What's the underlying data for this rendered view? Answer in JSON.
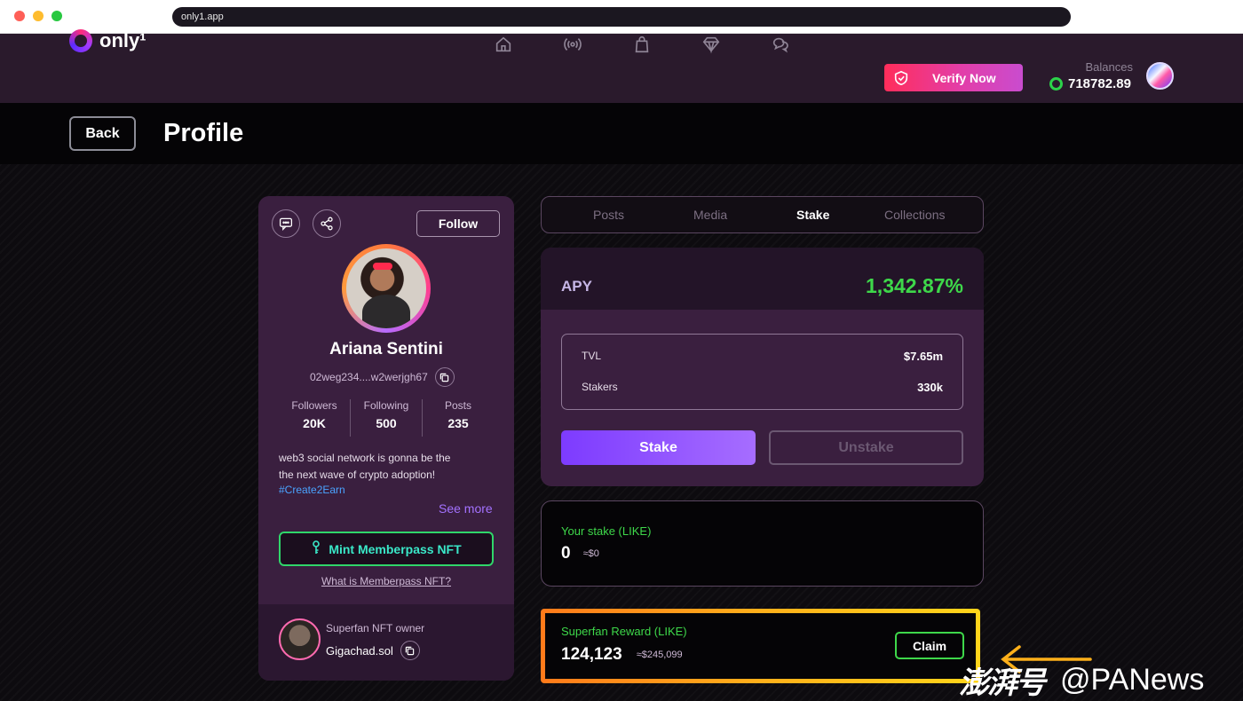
{
  "browser": {
    "url": "only1.app"
  },
  "header": {
    "logo_text": "only¹",
    "nav_icons": [
      "home-icon",
      "live-broadcast-icon",
      "shopping-bag-icon",
      "diamond-icon",
      "chat-bubbles-icon"
    ],
    "verify_label": "Verify Now",
    "balances_label": "Balances",
    "balances_value": "718782.89"
  },
  "page": {
    "back_label": "Back",
    "title": "Profile"
  },
  "profile": {
    "follow_label": "Follow",
    "name": "Ariana Sentini",
    "wallet": "02weg234....w2werjgh67",
    "stats": [
      {
        "label": "Followers",
        "value": "20K"
      },
      {
        "label": "Following",
        "value": "500"
      },
      {
        "label": "Posts",
        "value": "235"
      }
    ],
    "bio_line1": "web3 social network is gonna be the",
    "bio_line2": "the next wave of crypto adoption!",
    "hashtag": "#Create2Earn",
    "see_more": "See more",
    "mint_label": "Mint Memberpass NFT",
    "what_link": "What is Memberpass NFT?",
    "owner_label": "Superfan NFT owner",
    "owner_name": "Gigachad.sol"
  },
  "tabs": [
    {
      "label": "Posts",
      "active": false
    },
    {
      "label": "Media",
      "active": false
    },
    {
      "label": "Stake",
      "active": true
    },
    {
      "label": "Collections",
      "active": false
    }
  ],
  "stake": {
    "apy_label": "APY",
    "apy_value": "1,342.87%",
    "tvl_label": "TVL",
    "tvl_value": "$7.65m",
    "stakers_label": "Stakers",
    "stakers_value": "330k",
    "stake_label": "Stake",
    "unstake_label": "Unstake",
    "your_stake_label": "Your stake (LIKE)",
    "your_stake_value": "0",
    "your_stake_usd": "≈$0",
    "reward_label": "Superfan Reward (LIKE)",
    "reward_value": "124,123",
    "reward_usd": "≈$245,099",
    "claim_label": "Claim"
  },
  "watermark": {
    "cn": "澎湃号",
    "en": "@PANews"
  },
  "colors": {
    "accent_green": "#3ed84a",
    "accent_purple": "#7d3bff",
    "verify_red": "#ff2d5a",
    "highlight_orange": "#ffb01a"
  }
}
